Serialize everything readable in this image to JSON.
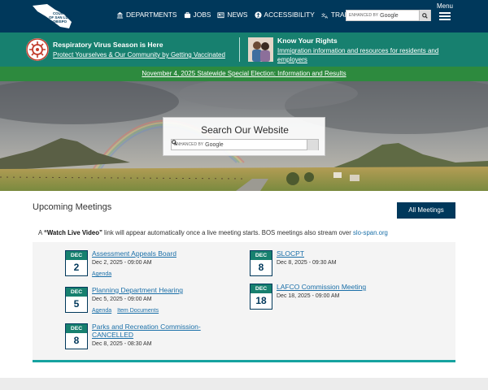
{
  "header": {
    "logo_lines": [
      "COUNTY",
      "OF SAN LUIS",
      "OBISPO"
    ],
    "nav": [
      {
        "label": "DEPARTMENTS",
        "icon": "building-icon"
      },
      {
        "label": "JOBS",
        "icon": "briefcase-icon"
      },
      {
        "label": "NEWS",
        "icon": "newspaper-icon"
      },
      {
        "label": "ACCESSIBILITY",
        "icon": "accessibility-icon"
      },
      {
        "label": "TRANSLATE",
        "icon": "translate-icon"
      }
    ],
    "search": {
      "enhanced": "ENHANCED BY",
      "google": "Google"
    },
    "menu_label": "Menu"
  },
  "alert": {
    "virus_title": "Respiratory Virus Season is Here",
    "virus_link": "Protect Yourselves & Our Community by Getting Vaccinated",
    "rights_title": "Know Your Rights",
    "rights_link": "Immigration information and resources for residents and employers"
  },
  "election": {
    "link": "November 4, 2025 Statewide Special Election: Information and Results"
  },
  "hero": {
    "search_title": "Search Our Website",
    "enhanced": "ENHANCED BY",
    "google": "Google"
  },
  "meetings": {
    "title": "Upcoming Meetings",
    "all_button": "All Meetings",
    "notice_prefix": "A ",
    "notice_bold": "“Watch Live Video”",
    "notice_mid": " link will appear automatically once a live meeting starts. BOS meetings also stream over ",
    "notice_link": "slo-span.org",
    "items": [
      {
        "month": "DEC",
        "day": "2",
        "title": "Assessment Appeals Board",
        "datetime": "Dec  2, 2025 - 09:00 AM",
        "links": [
          "Agenda"
        ]
      },
      {
        "month": "DEC",
        "day": "5",
        "title": "Planning Department Hearing",
        "datetime": "Dec  5, 2025 - 09:00 AM",
        "links": [
          "Agenda",
          "Item Documents"
        ]
      },
      {
        "month": "DEC",
        "day": "8",
        "title_line1": "Parks and Recreation Commission-",
        "title_line2": "CANCELLED",
        "datetime": "Dec  8, 2025 - 08:30 AM",
        "links": []
      },
      {
        "month": "DEC",
        "day": "8",
        "title": "SLOCPT",
        "datetime": "Dec  8, 2025 - 09:30 AM",
        "links": []
      },
      {
        "month": "DEC",
        "day": "18",
        "title": "LAFCO Commission Meeting",
        "datetime": "Dec 18, 2025 - 09:00 AM",
        "links": []
      }
    ]
  },
  "colors": {
    "header": "#00385b",
    "alert": "#17806f",
    "election": "#2d8a3e",
    "link": "#1a6fa8",
    "accent": "#16a2a0"
  }
}
